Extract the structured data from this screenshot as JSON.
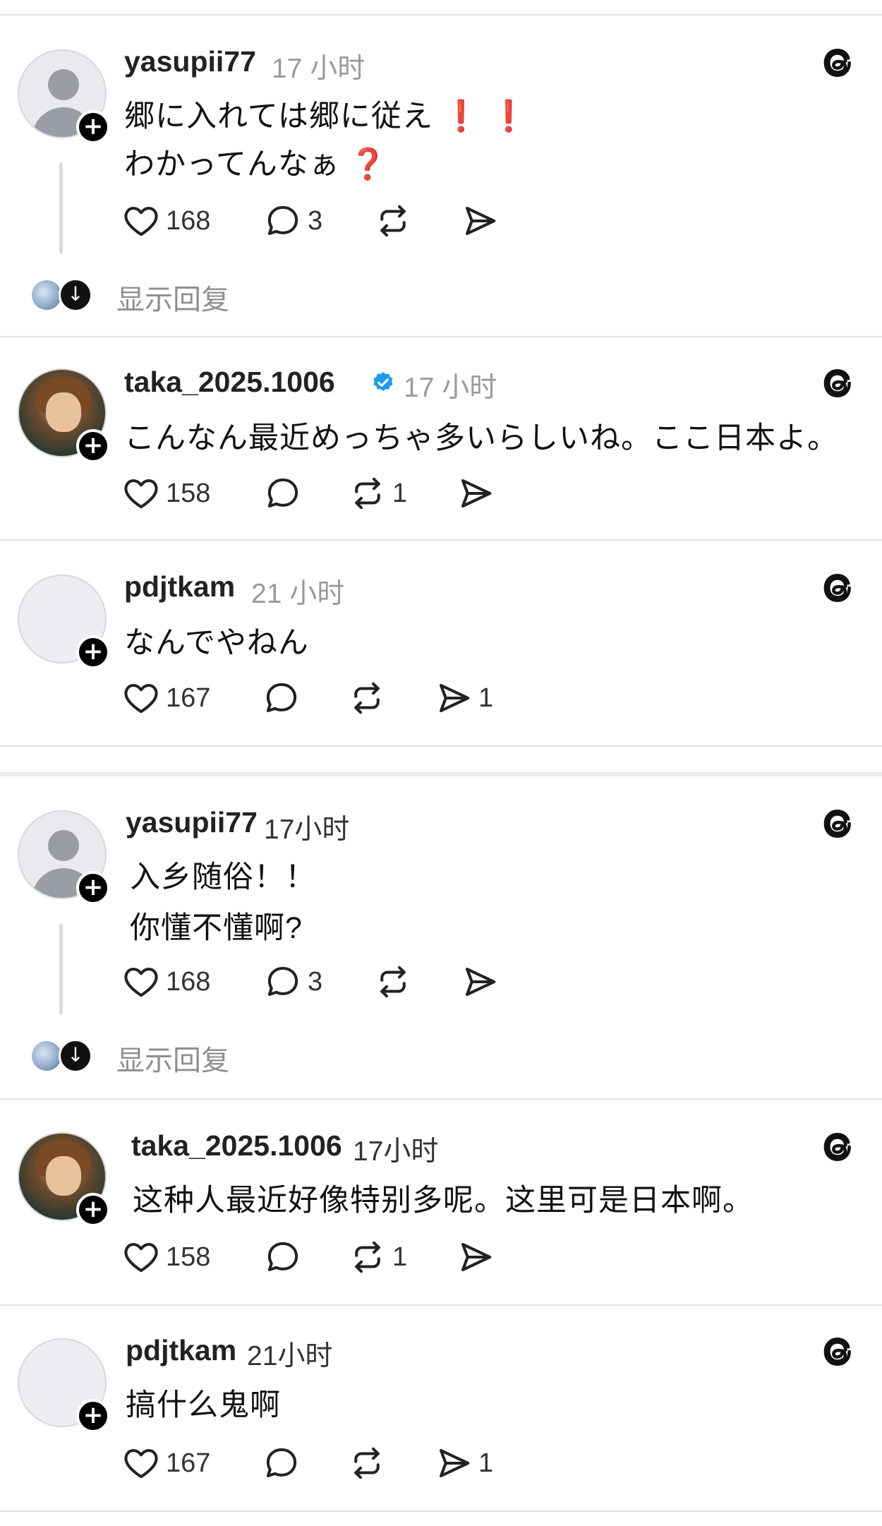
{
  "posts": [
    {
      "username": "yasupii77",
      "time": "17 小时",
      "lines": [
        "郷に入れては郷に従え",
        "わかってんなぁ"
      ],
      "line1_suffix": "❗ ❗",
      "line2_suffix": "❓",
      "likes": "168",
      "comments": "3",
      "reposts": "",
      "shares": "",
      "show_replies": "显示回复"
    },
    {
      "username": "taka_2025.1006",
      "time": "17 小时",
      "verified": true,
      "lines": [
        "こんなん最近めっちゃ多いらしいね。ここ日本よ。"
      ],
      "likes": "158",
      "comments": "",
      "reposts": "1",
      "shares": ""
    },
    {
      "username": "pdjtkam",
      "time": "21 小时",
      "lines": [
        "なんでやねん"
      ],
      "likes": "167",
      "comments": "",
      "reposts": "",
      "shares": "1"
    },
    {
      "username": "yasupii77",
      "time": "17小时",
      "lines": [
        "入乡随俗！！",
        "你懂不懂啊?"
      ],
      "likes": "168",
      "comments": "3",
      "reposts": "",
      "shares": "",
      "show_replies": "显示回复"
    },
    {
      "username": "taka_2025.1006",
      "time": "17小时",
      "lines": [
        "这种人最近好像特别多呢。这里可是日本啊。"
      ],
      "likes": "158",
      "comments": "",
      "reposts": "1",
      "shares": ""
    },
    {
      "username": "pdjtkam",
      "time": "21小时",
      "lines": [
        "搞什么鬼啊"
      ],
      "likes": "167",
      "comments": "",
      "reposts": "",
      "shares": "1"
    }
  ],
  "icons": {
    "like": "heart-icon",
    "comment": "comment-bubble-icon",
    "repost": "repost-icon",
    "share": "send-icon",
    "brand": "threads-logo-icon",
    "follow": "plus-icon",
    "verified": "verified-badge-icon"
  },
  "colors": {
    "verified": "#1d9bf0",
    "exclamation": "#d01414",
    "meta_gray": "#9a9a9a"
  }
}
